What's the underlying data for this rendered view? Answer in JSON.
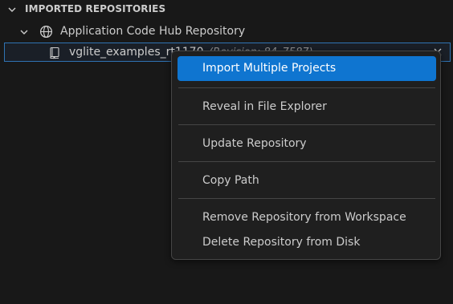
{
  "section": {
    "title": "IMPORTED REPOSITORIES"
  },
  "tree": {
    "hub_label": "Application Code Hub Repository",
    "repo_label": "vglite_examples_rt1170",
    "repo_desc": "(Revision: 84_7587)"
  },
  "menu": {
    "items": [
      {
        "label": "Import Multiple Projects",
        "active": true
      },
      {
        "label": "Reveal in File Explorer"
      },
      {
        "label": "Update Repository"
      },
      {
        "label": "Copy Path"
      },
      {
        "label": "Remove Repository from Workspace"
      },
      {
        "label": "Delete Repository from Disk"
      }
    ]
  },
  "colors": {
    "background": "#181818",
    "menu_background": "#1f1f1f",
    "highlight": "#0f75d0",
    "focus_border": "#2f73b3"
  },
  "icons": [
    "chevron-down-icon",
    "globe-icon",
    "repo-book-icon",
    "close-icon"
  ]
}
